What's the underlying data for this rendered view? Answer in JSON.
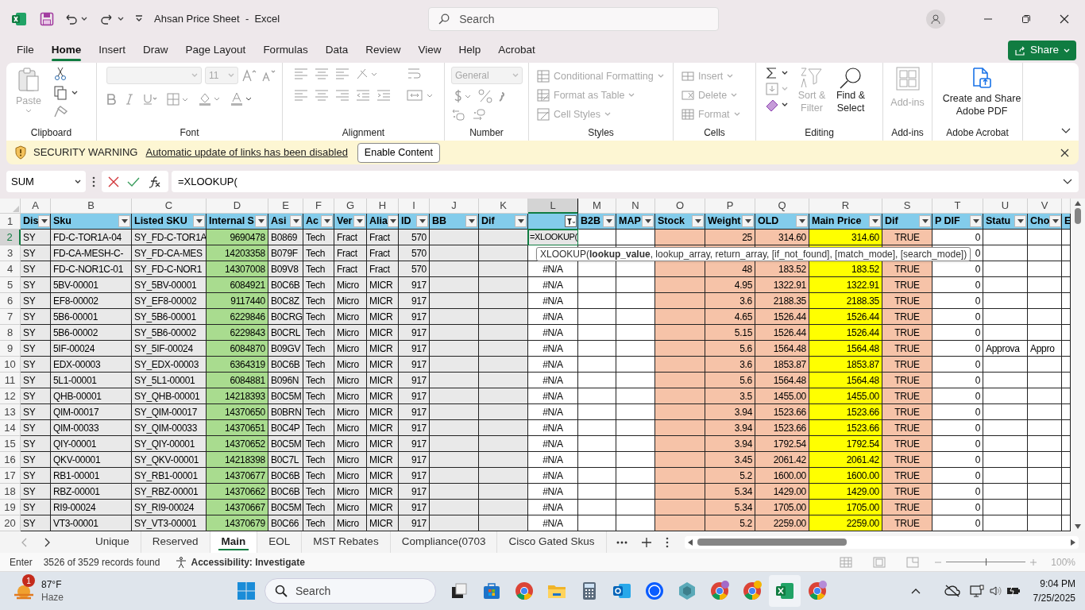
{
  "window": {
    "title": "Ahsan Price Sheet  -  Excel",
    "search_placeholder": "Search"
  },
  "menu_tabs": [
    {
      "label": "File",
      "selected": false
    },
    {
      "label": "Home",
      "selected": true
    },
    {
      "label": "Insert",
      "selected": false
    },
    {
      "label": "Draw",
      "selected": false
    },
    {
      "label": "Page Layout",
      "selected": false
    },
    {
      "label": "Formulas",
      "selected": false
    },
    {
      "label": "Data",
      "selected": false
    },
    {
      "label": "Review",
      "selected": false
    },
    {
      "label": "View",
      "selected": false
    },
    {
      "label": "Help",
      "selected": false
    },
    {
      "label": "Acrobat",
      "selected": false
    }
  ],
  "share_button": "Share",
  "ribbon": {
    "groups": [
      {
        "kind": "clipboard",
        "label": "Clipboard",
        "items": [
          {
            "label": "Paste",
            "disabled": true
          }
        ]
      },
      {
        "kind": "font",
        "label": "Font",
        "items": [
          {
            "label": "11",
            "disabled": true
          }
        ]
      },
      {
        "kind": "alignment",
        "label": "Alignment"
      },
      {
        "kind": "number",
        "label": "Number",
        "items": [
          {
            "label": "General",
            "disabled": true
          }
        ]
      },
      {
        "kind": "styles",
        "label": "Styles",
        "items": [
          {
            "label": "Conditional Formatting",
            "disabled": true
          },
          {
            "label": "Format as Table",
            "disabled": true
          },
          {
            "label": "Cell Styles",
            "disabled": true
          }
        ]
      },
      {
        "kind": "cells",
        "label": "Cells",
        "items": [
          {
            "label": "Insert",
            "disabled": true
          },
          {
            "label": "Delete",
            "disabled": true
          },
          {
            "label": "Format",
            "disabled": true
          }
        ]
      },
      {
        "kind": "editing",
        "label": "Editing",
        "items": [
          {
            "label": "Sort & Filter",
            "disabled": true
          },
          {
            "label": "Find & Select",
            "disabled": false
          }
        ]
      },
      {
        "kind": "addins",
        "label": "Add-ins",
        "items": [
          {
            "label": "Add-ins",
            "disabled": true
          }
        ]
      },
      {
        "kind": "acrobat",
        "label": "Adobe Acrobat",
        "items": [
          {
            "label": "Create and Share Adobe PDF",
            "disabled": false
          }
        ]
      }
    ]
  },
  "security_bar": {
    "title": "SECURITY WARNING",
    "message": "Automatic update of links has been disabled",
    "button": "Enable Content"
  },
  "formula_bar": {
    "name_box": "SUM",
    "formula": "=XLOOKUP("
  },
  "sheet": {
    "columns": [
      {
        "letter": "A",
        "heading": "Dis",
        "selected": false,
        "filtered": false
      },
      {
        "letter": "B",
        "heading": "Sku",
        "selected": false,
        "filtered": false
      },
      {
        "letter": "C",
        "heading": "Listed SKU",
        "selected": false,
        "filtered": false
      },
      {
        "letter": "D",
        "heading": "Internal S",
        "selected": false,
        "filtered": false
      },
      {
        "letter": "E",
        "heading": "Asi",
        "selected": false,
        "filtered": false
      },
      {
        "letter": "F",
        "heading": "Ac",
        "selected": false,
        "filtered": false
      },
      {
        "letter": "G",
        "heading": "Ver",
        "selected": false,
        "filtered": false
      },
      {
        "letter": "H",
        "heading": "Alia",
        "selected": false,
        "filtered": false
      },
      {
        "letter": "I",
        "heading": "ID",
        "selected": false,
        "filtered": false
      },
      {
        "letter": "J",
        "heading": "BB",
        "selected": false,
        "filtered": false
      },
      {
        "letter": "K",
        "heading": "Dif",
        "selected": false,
        "filtered": false
      },
      {
        "letter": "L",
        "selected": true,
        "filtered": true
      },
      {
        "letter": "M",
        "heading": "B2B",
        "selected": false,
        "filtered": false
      },
      {
        "letter": "N",
        "heading": "MAP",
        "selected": false,
        "filtered": false
      },
      {
        "letter": "O",
        "heading": "Stock",
        "selected": false,
        "filtered": false
      },
      {
        "letter": "P",
        "heading": "Weight",
        "selected": false,
        "filtered": false
      },
      {
        "letter": "Q",
        "heading": "OLD",
        "selected": false,
        "filtered": false
      },
      {
        "letter": "R",
        "heading": "Main Price",
        "selected": false,
        "filtered": false
      },
      {
        "letter": "S",
        "heading": "Dif",
        "selected": false,
        "filtered": false
      },
      {
        "letter": "T",
        "heading": "P DIF",
        "selected": false,
        "filtered": false
      },
      {
        "letter": "U",
        "heading": "Statu",
        "selected": false,
        "filtered": false
      },
      {
        "letter": "V",
        "heading": "Cho",
        "selected": false,
        "filtered": false
      },
      {
        "heading": "E"
      }
    ],
    "header_row_number": "1",
    "rows": [
      {
        "number": "2",
        "selected": true,
        "cells": {
          "A": "SY",
          "B": "FD-C-TOR1A-04",
          "C": "SY_FD-C-TOR1A",
          "D": "9690478",
          "E": "B0869",
          "F": "Tech",
          "G": "Fract",
          "H": "Fract",
          "I": "570",
          "L": "=XLOOKUP(",
          "P": "25",
          "Q": "314.60",
          "R": "314.60",
          "S": "TRUE",
          "T": "0"
        }
      },
      {
        "number": "3",
        "selected": false,
        "cells": {
          "A": "SY",
          "B": "FD-CA-MESH-C-",
          "C": "SY_FD-CA-MES",
          "D": "14203358",
          "E": "B079F",
          "F": "Tech",
          "G": "Fract",
          "H": "Fract",
          "I": "570",
          "T": "0"
        }
      },
      {
        "number": "4",
        "selected": false,
        "cells": {
          "A": "SY",
          "B": "FD-C-NOR1C-01",
          "C": "SY_FD-C-NOR1",
          "D": "14307008",
          "E": "B09V8",
          "F": "Tech",
          "G": "Fract",
          "H": "Fract",
          "I": "570",
          "L": "#N/A",
          "P": "48",
          "Q": "183.52",
          "R": "183.52",
          "S": "TRUE",
          "T": "0"
        }
      },
      {
        "number": "5",
        "selected": false,
        "cells": {
          "A": "SY",
          "B": "5BV-00001",
          "C": "SY_5BV-00001",
          "D": "6084921",
          "E": "B0C6B",
          "F": "Tech",
          "G": "Micro",
          "H": "MICR",
          "I": "917",
          "L": "#N/A",
          "P": "4.95",
          "Q": "1322.91",
          "R": "1322.91",
          "S": "TRUE",
          "T": "0"
        }
      },
      {
        "number": "6",
        "selected": false,
        "cells": {
          "A": "SY",
          "B": "EF8-00002",
          "C": "SY_EF8-00002",
          "D": "9117440",
          "E": "B0C8Z",
          "F": "Tech",
          "G": "Micro",
          "H": "MICR",
          "I": "917",
          "L": "#N/A",
          "P": "3.6",
          "Q": "2188.35",
          "R": "2188.35",
          "S": "TRUE",
          "T": "0"
        }
      },
      {
        "number": "7",
        "selected": false,
        "cells": {
          "A": "SY",
          "B": "5B6-00001",
          "C": "SY_5B6-00001",
          "D": "6229846",
          "E": "B0CRG",
          "F": "Tech",
          "G": "Micro",
          "H": "MICR",
          "I": "917",
          "L": "#N/A",
          "P": "4.65",
          "Q": "1526.44",
          "R": "1526.44",
          "S": "TRUE",
          "T": "0"
        }
      },
      {
        "number": "8",
        "selected": false,
        "cells": {
          "A": "SY",
          "B": "5B6-00002",
          "C": "SY_5B6-00002",
          "D": "6229843",
          "E": "B0CRL",
          "F": "Tech",
          "G": "Micro",
          "H": "MICR",
          "I": "917",
          "L": "#N/A",
          "P": "5.15",
          "Q": "1526.44",
          "R": "1526.44",
          "S": "TRUE",
          "T": "0"
        }
      },
      {
        "number": "9",
        "selected": false,
        "cells": {
          "A": "SY",
          "B": "5IF-00024",
          "C": "SY_5IF-00024",
          "D": "6084870",
          "E": "B09GV",
          "F": "Tech",
          "G": "Micro",
          "H": "MICR",
          "I": "917",
          "L": "#N/A",
          "P": "5.6",
          "Q": "1564.48",
          "R": "1564.48",
          "S": "TRUE",
          "T": "0",
          "U": "Approva",
          "V": "Appro"
        }
      },
      {
        "number": "10",
        "selected": false,
        "cells": {
          "A": "SY",
          "B": "EDX-00003",
          "C": "SY_EDX-00003",
          "D": "6364319",
          "E": "B0C6B",
          "F": "Tech",
          "G": "Micro",
          "H": "MICR",
          "I": "917",
          "L": "#N/A",
          "P": "3.6",
          "Q": "1853.87",
          "R": "1853.87",
          "S": "TRUE",
          "T": "0"
        }
      },
      {
        "number": "11",
        "selected": false,
        "cells": {
          "A": "SY",
          "B": "5L1-00001",
          "C": "SY_5L1-00001",
          "D": "6084881",
          "E": "B096N",
          "F": "Tech",
          "G": "Micro",
          "H": "MICR",
          "I": "917",
          "L": "#N/A",
          "P": "5.6",
          "Q": "1564.48",
          "R": "1564.48",
          "S": "TRUE",
          "T": "0"
        }
      },
      {
        "number": "12",
        "selected": false,
        "cells": {
          "A": "SY",
          "B": "QHB-00001",
          "C": "SY_QHB-00001",
          "D": "14218393",
          "E": "B0C5M",
          "F": "Tech",
          "G": "Micro",
          "H": "MICR",
          "I": "917",
          "L": "#N/A",
          "P": "3.5",
          "Q": "1455.00",
          "R": "1455.00",
          "S": "TRUE",
          "T": "0"
        }
      },
      {
        "number": "13",
        "selected": false,
        "cells": {
          "A": "SY",
          "B": "QIM-00017",
          "C": "SY_QIM-00017",
          "D": "14370650",
          "E": "B0BRN",
          "F": "Tech",
          "G": "Micro",
          "H": "MICR",
          "I": "917",
          "L": "#N/A",
          "P": "3.94",
          "Q": "1523.66",
          "R": "1523.66",
          "S": "TRUE",
          "T": "0"
        }
      },
      {
        "number": "14",
        "selected": false,
        "cells": {
          "A": "SY",
          "B": "QIM-00033",
          "C": "SY_QIM-00033",
          "D": "14370651",
          "E": "B0C4P",
          "F": "Tech",
          "G": "Micro",
          "H": "MICR",
          "I": "917",
          "L": "#N/A",
          "P": "3.94",
          "Q": "1523.66",
          "R": "1523.66",
          "S": "TRUE",
          "T": "0"
        }
      },
      {
        "number": "15",
        "selected": false,
        "cells": {
          "A": "SY",
          "B": "QIY-00001",
          "C": "SY_QIY-00001",
          "D": "14370652",
          "E": "B0C5M",
          "F": "Tech",
          "G": "Micro",
          "H": "MICR",
          "I": "917",
          "L": "#N/A",
          "P": "3.94",
          "Q": "1792.54",
          "R": "1792.54",
          "S": "TRUE",
          "T": "0"
        }
      },
      {
        "number": "16",
        "selected": false,
        "cells": {
          "A": "SY",
          "B": "QKV-00001",
          "C": "SY_QKV-00001",
          "D": "14218398",
          "E": "B0C7L",
          "F": "Tech",
          "G": "Micro",
          "H": "MICR",
          "I": "917",
          "L": "#N/A",
          "P": "3.45",
          "Q": "2061.42",
          "R": "2061.42",
          "S": "TRUE",
          "T": "0"
        }
      },
      {
        "number": "17",
        "selected": false,
        "cells": {
          "A": "SY",
          "B": "RB1-00001",
          "C": "SY_RB1-00001",
          "D": "14370677",
          "E": "B0C6B",
          "F": "Tech",
          "G": "Micro",
          "H": "MICR",
          "I": "917",
          "L": "#N/A",
          "P": "5.2",
          "Q": "1600.00",
          "R": "1600.00",
          "S": "TRUE",
          "T": "0"
        }
      },
      {
        "number": "18",
        "selected": false,
        "cells": {
          "A": "SY",
          "B": "RBZ-00001",
          "C": "SY_RBZ-00001",
          "D": "14370662",
          "E": "B0C6B",
          "F": "Tech",
          "G": "Micro",
          "H": "MICR",
          "I": "917",
          "L": "#N/A",
          "P": "5.34",
          "Q": "1429.00",
          "R": "1429.00",
          "S": "TRUE",
          "T": "0"
        }
      },
      {
        "number": "19",
        "selected": false,
        "cells": {
          "A": "SY",
          "B": "RI9-00024",
          "C": "SY_RI9-00024",
          "D": "14370667",
          "E": "B0C5M",
          "F": "Tech",
          "G": "Micro",
          "H": "MICR",
          "I": "917",
          "L": "#N/A",
          "P": "5.34",
          "Q": "1705.00",
          "R": "1705.00",
          "S": "TRUE",
          "T": "0"
        }
      },
      {
        "number": "20",
        "selected": false,
        "cells": {
          "A": "SY",
          "B": "VT3-00001",
          "C": "SY_VT3-00001",
          "D": "14370679",
          "E": "B0C66",
          "F": "Tech",
          "G": "Micro",
          "H": "MICR",
          "I": "917",
          "L": "#N/A",
          "P": "5.2",
          "Q": "2259.00",
          "R": "2259.00",
          "S": "TRUE",
          "T": "0"
        }
      }
    ],
    "formula_tooltip": "XLOOKUP(**lookup_value**, lookup_array, return_array, [if_not_found], [match_mode], [search_mode])"
  },
  "sheet_tabs": [
    {
      "label": "Unique",
      "selected": false
    },
    {
      "label": "Reserved",
      "selected": false
    },
    {
      "label": "Main",
      "selected": true
    },
    {
      "label": "EOL",
      "selected": false
    },
    {
      "label": "MST Rebates",
      "selected": false
    },
    {
      "label": "Compliance(0703",
      "selected": false
    },
    {
      "label": "Cisco Gated Skus",
      "selected": false
    }
  ],
  "status_bar": {
    "mode": "Enter",
    "records": "3526 of 3529 records found",
    "accessibility": "Accessibility: Investigate",
    "zoom_slider": {
      "level": 0.5
    },
    "zoom": "100%"
  },
  "taskbar": {
    "weather": {
      "badge": "1",
      "temperature": "87°F",
      "condition": "Haze"
    },
    "search_placeholder": "Search",
    "time": "9:04 PM",
    "date": "7/25/2025"
  }
}
